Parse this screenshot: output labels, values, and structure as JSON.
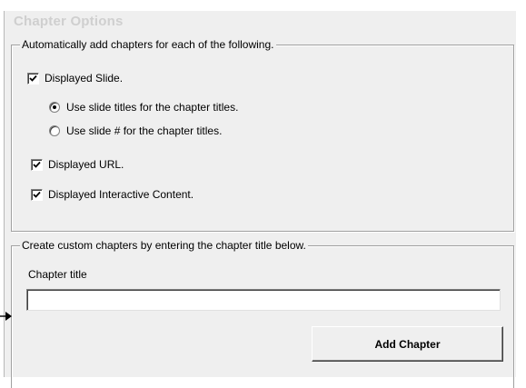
{
  "panel": {
    "title": "Chapter Options"
  },
  "auto_group": {
    "legend": "Automatically add chapters for each of the following.",
    "displayed_slide": {
      "label": "Displayed Slide.",
      "checked": true
    },
    "radio_slide_titles": {
      "label": "Use slide titles for the chapter titles.",
      "selected": true
    },
    "radio_slide_number": {
      "label": "Use slide # for the chapter titles.",
      "selected": false
    },
    "displayed_url": {
      "label": "Displayed URL.",
      "checked": true
    },
    "displayed_interactive": {
      "label": "Displayed Interactive Content.",
      "checked": true
    }
  },
  "custom_group": {
    "legend": "Create custom chapters by entering the chapter title below.",
    "chapter_title_label": "Chapter title",
    "chapter_title_value": "",
    "add_button_label": "Add Chapter"
  },
  "icons": {
    "check": "check-icon",
    "arrow": "arrow-right-icon"
  }
}
